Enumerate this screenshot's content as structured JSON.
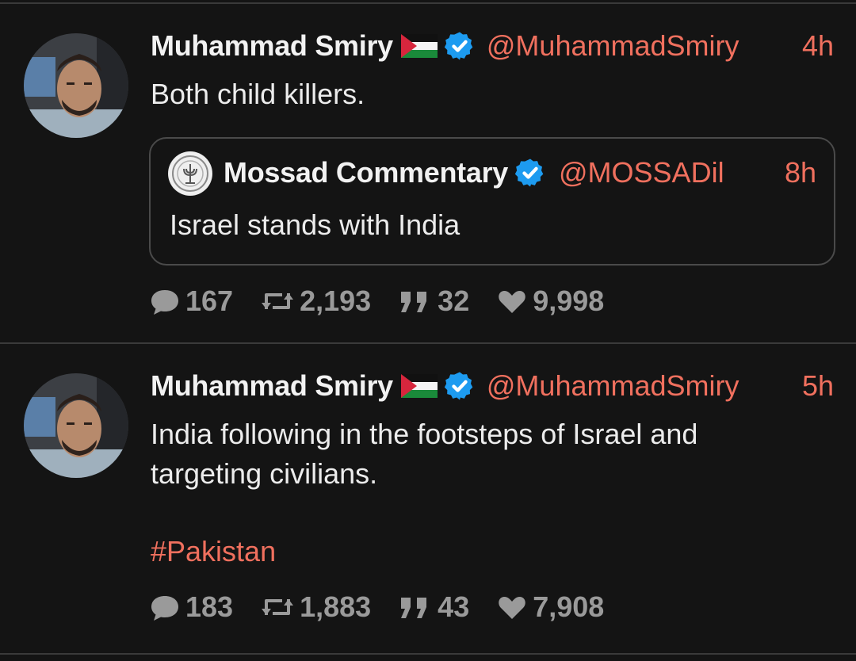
{
  "tweets": [
    {
      "author": "Muhammad Smiry",
      "flag_icon": "palestine-flag-icon",
      "verified_icon": "verified-badge-icon",
      "handle": "@MuhammadSmiry",
      "time": "4h",
      "text": "Both child killers.",
      "quote": {
        "author": "Mossad Commentary",
        "handle": "@MOSSADil",
        "time": "8h",
        "text": "Israel stands with India"
      },
      "stats": {
        "replies": "167",
        "retweets": "2,193",
        "quotes": "32",
        "likes": "9,998"
      }
    },
    {
      "author": "Muhammad Smiry",
      "flag_icon": "palestine-flag-icon",
      "verified_icon": "verified-badge-icon",
      "handle": "@MuhammadSmiry",
      "time": "5h",
      "text": "India following in the footsteps of Israel and targeting civilians.",
      "hashtag": "#Pakistan",
      "stats": {
        "replies": "183",
        "retweets": "1,883",
        "quotes": "43",
        "likes": "7,908"
      }
    }
  ],
  "colors": {
    "background": "#141414",
    "accent": "#f0705e",
    "verified": "#1d9bf0",
    "muted": "#9a9a9a",
    "divider": "#3a3a3a"
  }
}
